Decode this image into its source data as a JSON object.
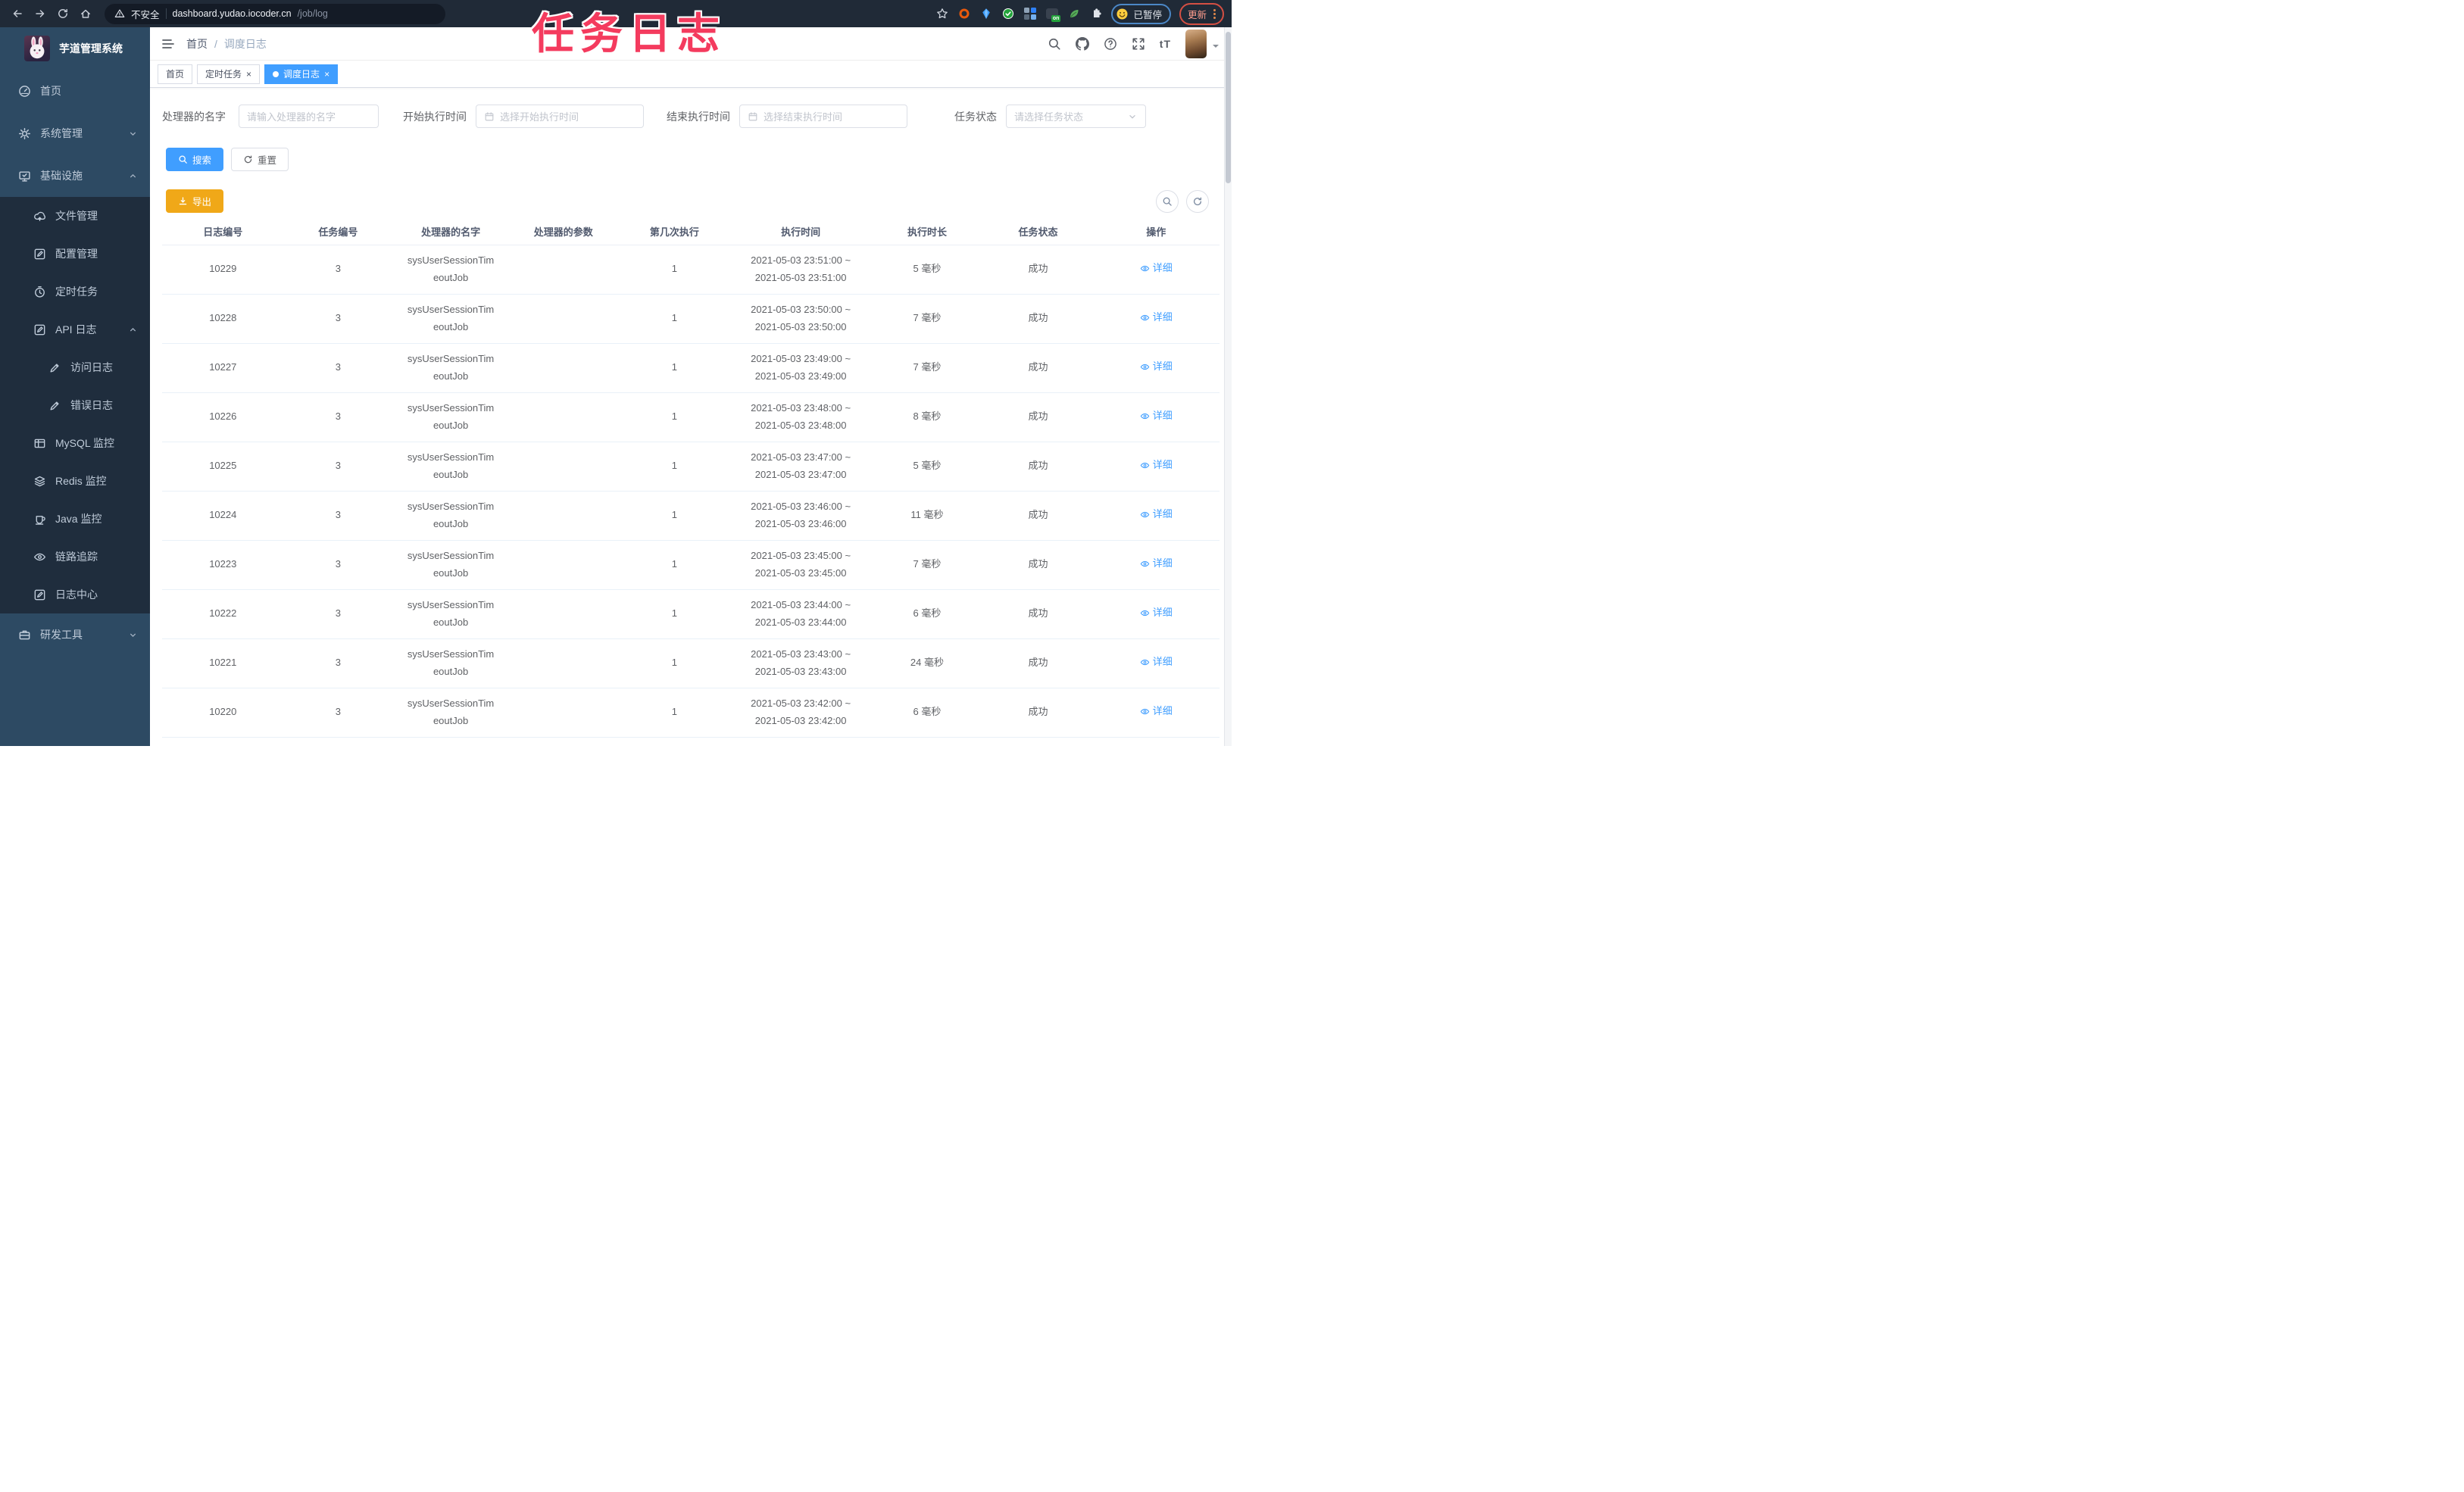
{
  "browser": {
    "security_label": "不安全",
    "url_host": "dashboard.yudao.iocoder.cn",
    "url_path": "/job/log",
    "paused_label": "已暂停",
    "update_label": "更新",
    "ext_on_label": "on"
  },
  "overlay": {
    "title": "任务日志"
  },
  "sidebar": {
    "title": "芋道管理系统",
    "items": [
      {
        "label": "首页"
      },
      {
        "label": "系统管理"
      },
      {
        "label": "基础设施"
      },
      {
        "label": "文件管理"
      },
      {
        "label": "配置管理"
      },
      {
        "label": "定时任务"
      },
      {
        "label": "API 日志"
      },
      {
        "label": "访问日志"
      },
      {
        "label": "错误日志"
      },
      {
        "label": "MySQL 监控"
      },
      {
        "label": "Redis 监控"
      },
      {
        "label": "Java 监控"
      },
      {
        "label": "链路追踪"
      },
      {
        "label": "日志中心"
      },
      {
        "label": "研发工具"
      }
    ]
  },
  "header": {
    "breadcrumb": [
      "首页",
      "调度日志"
    ],
    "breadcrumb_sep": "/"
  },
  "glyphs": {
    "close": "×",
    "text_size": "tT"
  },
  "tabs": [
    {
      "label": "首页",
      "active": false,
      "closable": false
    },
    {
      "label": "定时任务",
      "active": false,
      "closable": true
    },
    {
      "label": "调度日志",
      "active": true,
      "closable": true
    }
  ],
  "filters": {
    "handler_label": "处理器的名字",
    "handler_placeholder": "请输入处理器的名字",
    "start_label": "开始执行时间",
    "start_placeholder": "选择开始执行时间",
    "end_label": "结束执行时间",
    "end_placeholder": "选择结束执行时间",
    "status_label": "任务状态",
    "status_placeholder": "请选择任务状态"
  },
  "actions": {
    "search": "搜索",
    "reset": "重置",
    "export": "导出"
  },
  "table": {
    "columns": [
      "日志编号",
      "任务编号",
      "处理器的名字",
      "处理器的参数",
      "第几次执行",
      "执行时间",
      "执行时长",
      "任务状态",
      "操作"
    ],
    "action_label": "详细",
    "rows": [
      {
        "id": "10229",
        "job_id": "3",
        "handler": [
          "sysUserSessionTim",
          "eoutJob"
        ],
        "param": "",
        "count": "1",
        "time": [
          "2021-05-03 23:51:00 ~",
          "2021-05-03 23:51:00"
        ],
        "duration": "5 毫秒",
        "status": "成功"
      },
      {
        "id": "10228",
        "job_id": "3",
        "handler": [
          "sysUserSessionTim",
          "eoutJob"
        ],
        "param": "",
        "count": "1",
        "time": [
          "2021-05-03 23:50:00 ~",
          "2021-05-03 23:50:00"
        ],
        "duration": "7 毫秒",
        "status": "成功"
      },
      {
        "id": "10227",
        "job_id": "3",
        "handler": [
          "sysUserSessionTim",
          "eoutJob"
        ],
        "param": "",
        "count": "1",
        "time": [
          "2021-05-03 23:49:00 ~",
          "2021-05-03 23:49:00"
        ],
        "duration": "7 毫秒",
        "status": "成功"
      },
      {
        "id": "10226",
        "job_id": "3",
        "handler": [
          "sysUserSessionTim",
          "eoutJob"
        ],
        "param": "",
        "count": "1",
        "time": [
          "2021-05-03 23:48:00 ~",
          "2021-05-03 23:48:00"
        ],
        "duration": "8 毫秒",
        "status": "成功"
      },
      {
        "id": "10225",
        "job_id": "3",
        "handler": [
          "sysUserSessionTim",
          "eoutJob"
        ],
        "param": "",
        "count": "1",
        "time": [
          "2021-05-03 23:47:00 ~",
          "2021-05-03 23:47:00"
        ],
        "duration": "5 毫秒",
        "status": "成功"
      },
      {
        "id": "10224",
        "job_id": "3",
        "handler": [
          "sysUserSessionTim",
          "eoutJob"
        ],
        "param": "",
        "count": "1",
        "time": [
          "2021-05-03 23:46:00 ~",
          "2021-05-03 23:46:00"
        ],
        "duration": "11 毫秒",
        "status": "成功"
      },
      {
        "id": "10223",
        "job_id": "3",
        "handler": [
          "sysUserSessionTim",
          "eoutJob"
        ],
        "param": "",
        "count": "1",
        "time": [
          "2021-05-03 23:45:00 ~",
          "2021-05-03 23:45:00"
        ],
        "duration": "7 毫秒",
        "status": "成功"
      },
      {
        "id": "10222",
        "job_id": "3",
        "handler": [
          "sysUserSessionTim",
          "eoutJob"
        ],
        "param": "",
        "count": "1",
        "time": [
          "2021-05-03 23:44:00 ~",
          "2021-05-03 23:44:00"
        ],
        "duration": "6 毫秒",
        "status": "成功"
      },
      {
        "id": "10221",
        "job_id": "3",
        "handler": [
          "sysUserSessionTim",
          "eoutJob"
        ],
        "param": "",
        "count": "1",
        "time": [
          "2021-05-03 23:43:00 ~",
          "2021-05-03 23:43:00"
        ],
        "duration": "24 毫秒",
        "status": "成功"
      },
      {
        "id": "10220",
        "job_id": "3",
        "handler": [
          "sysUserSessionTim",
          "eoutJob"
        ],
        "param": "",
        "count": "1",
        "time": [
          "2021-05-03 23:42:00 ~",
          "2021-05-03 23:42:00"
        ],
        "duration": "6 毫秒",
        "status": "成功"
      }
    ]
  },
  "colors": {
    "primary": "#409eff",
    "warning_button": "#f0a818",
    "sidebar_bg": "#2d4a63",
    "submenu_bg": "#1f2d3d",
    "overlay_text": "#f43b5e",
    "success_text": "#606266",
    "link": "#409eff"
  }
}
